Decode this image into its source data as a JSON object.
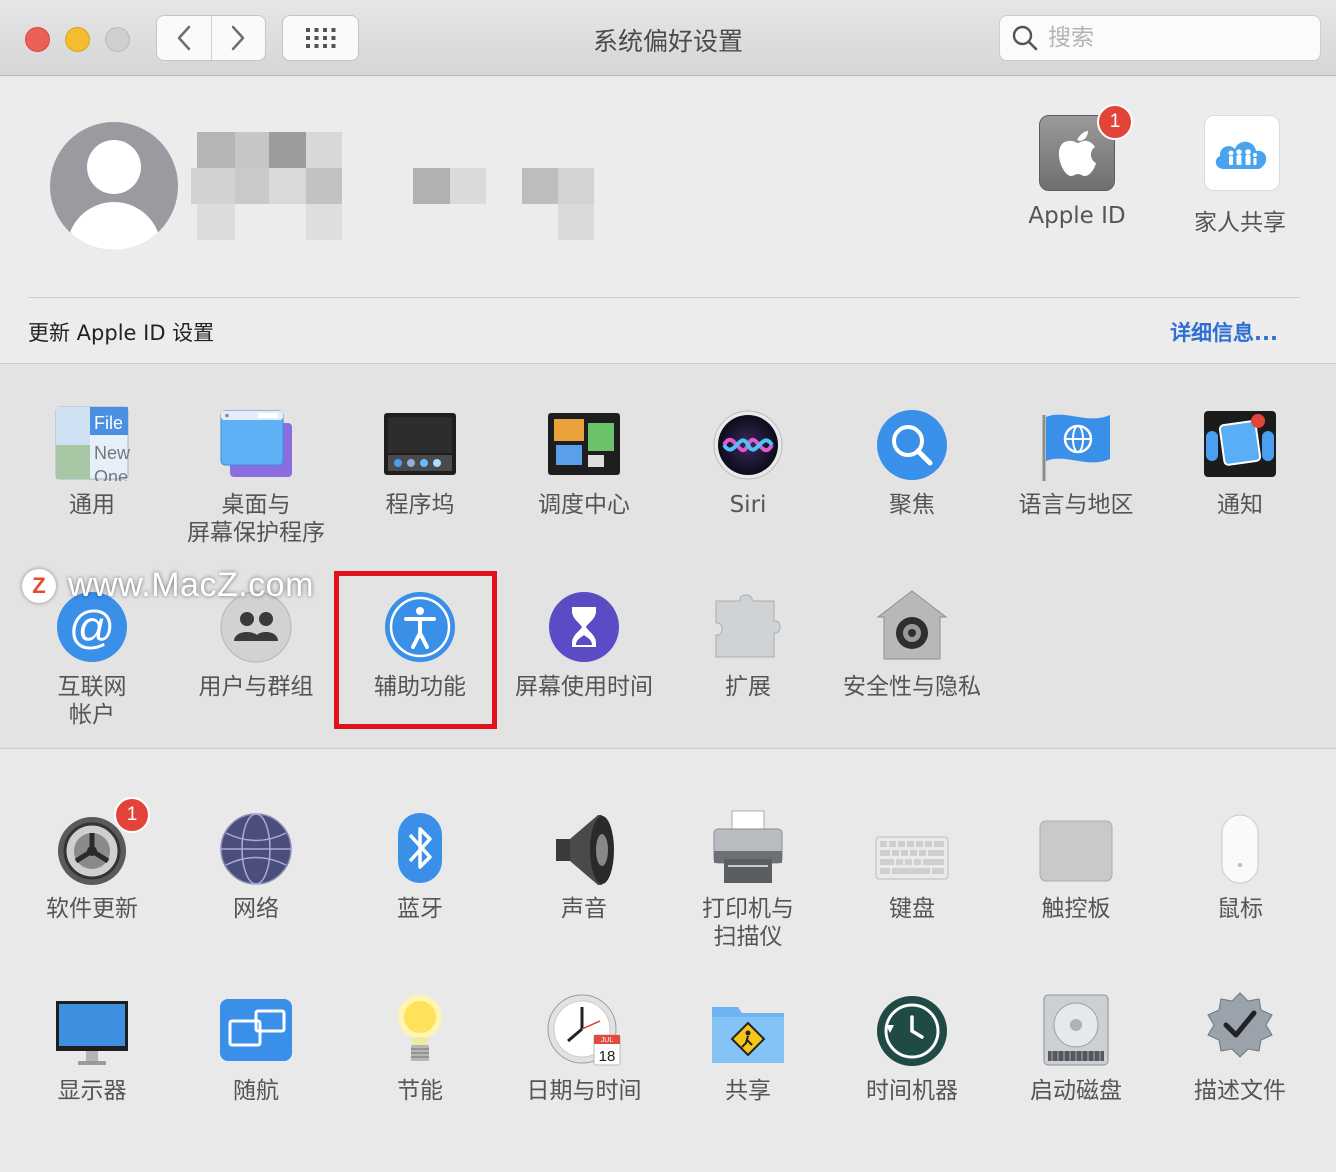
{
  "window": {
    "title": "系统偏好设置",
    "search_placeholder": "搜索"
  },
  "account": {
    "notice": "更新 Apple ID 设置",
    "details_link": "详细信息...",
    "apple_id": {
      "label": "Apple ID",
      "badge": "1"
    },
    "family": {
      "label": "家人共享"
    }
  },
  "section1": {
    "row1": [
      {
        "label": "通用",
        "icon": "general-icon"
      },
      {
        "label": "桌面与\n屏幕保护程序",
        "icon": "desktop-icon"
      },
      {
        "label": "程序坞",
        "icon": "dock-icon"
      },
      {
        "label": "调度中心",
        "icon": "mission-control-icon"
      },
      {
        "label": "Siri",
        "icon": "siri-icon"
      },
      {
        "label": "聚焦",
        "icon": "spotlight-icon"
      },
      {
        "label": "语言与地区",
        "icon": "language-flag-icon"
      },
      {
        "label": "通知",
        "icon": "notifications-icon"
      }
    ],
    "row2": [
      {
        "label": "互联网\n帐户",
        "icon": "internet-accounts-icon"
      },
      {
        "label": "用户与群组",
        "icon": "users-icon"
      },
      {
        "label": "辅助功能",
        "icon": "accessibility-icon"
      },
      {
        "label": "屏幕使用时间",
        "icon": "screen-time-icon"
      },
      {
        "label": "扩展",
        "icon": "extensions-icon"
      },
      {
        "label": "安全性与隐私",
        "icon": "security-icon"
      }
    ],
    "general_icon_text": [
      "File",
      "New",
      "One"
    ]
  },
  "section2": {
    "row1": [
      {
        "label": "软件更新",
        "icon": "software-update-icon",
        "badge": "1"
      },
      {
        "label": "网络",
        "icon": "network-icon"
      },
      {
        "label": "蓝牙",
        "icon": "bluetooth-icon"
      },
      {
        "label": "声音",
        "icon": "sound-icon"
      },
      {
        "label": "打印机与\n扫描仪",
        "icon": "printer-icon"
      },
      {
        "label": "键盘",
        "icon": "keyboard-icon"
      },
      {
        "label": "触控板",
        "icon": "trackpad-icon"
      },
      {
        "label": "鼠标",
        "icon": "mouse-icon"
      }
    ],
    "row2": [
      {
        "label": "显示器",
        "icon": "display-icon"
      },
      {
        "label": "随航",
        "icon": "sidecar-icon"
      },
      {
        "label": "节能",
        "icon": "energy-saver-icon"
      },
      {
        "label": "日期与时间",
        "icon": "date-time-icon"
      },
      {
        "label": "共享",
        "icon": "sharing-icon"
      },
      {
        "label": "时间机器",
        "icon": "time-machine-icon"
      },
      {
        "label": "启动磁盘",
        "icon": "startup-disk-icon"
      },
      {
        "label": "描述文件",
        "icon": "profiles-icon"
      }
    ],
    "calendar_month": "JUL",
    "calendar_day": "18"
  },
  "watermark": {
    "text": "www.MacZ.com",
    "logo": "Z"
  },
  "colors": {
    "highlight": "#e0131c",
    "link": "#2e6fd3",
    "badge": "#e3443a"
  }
}
